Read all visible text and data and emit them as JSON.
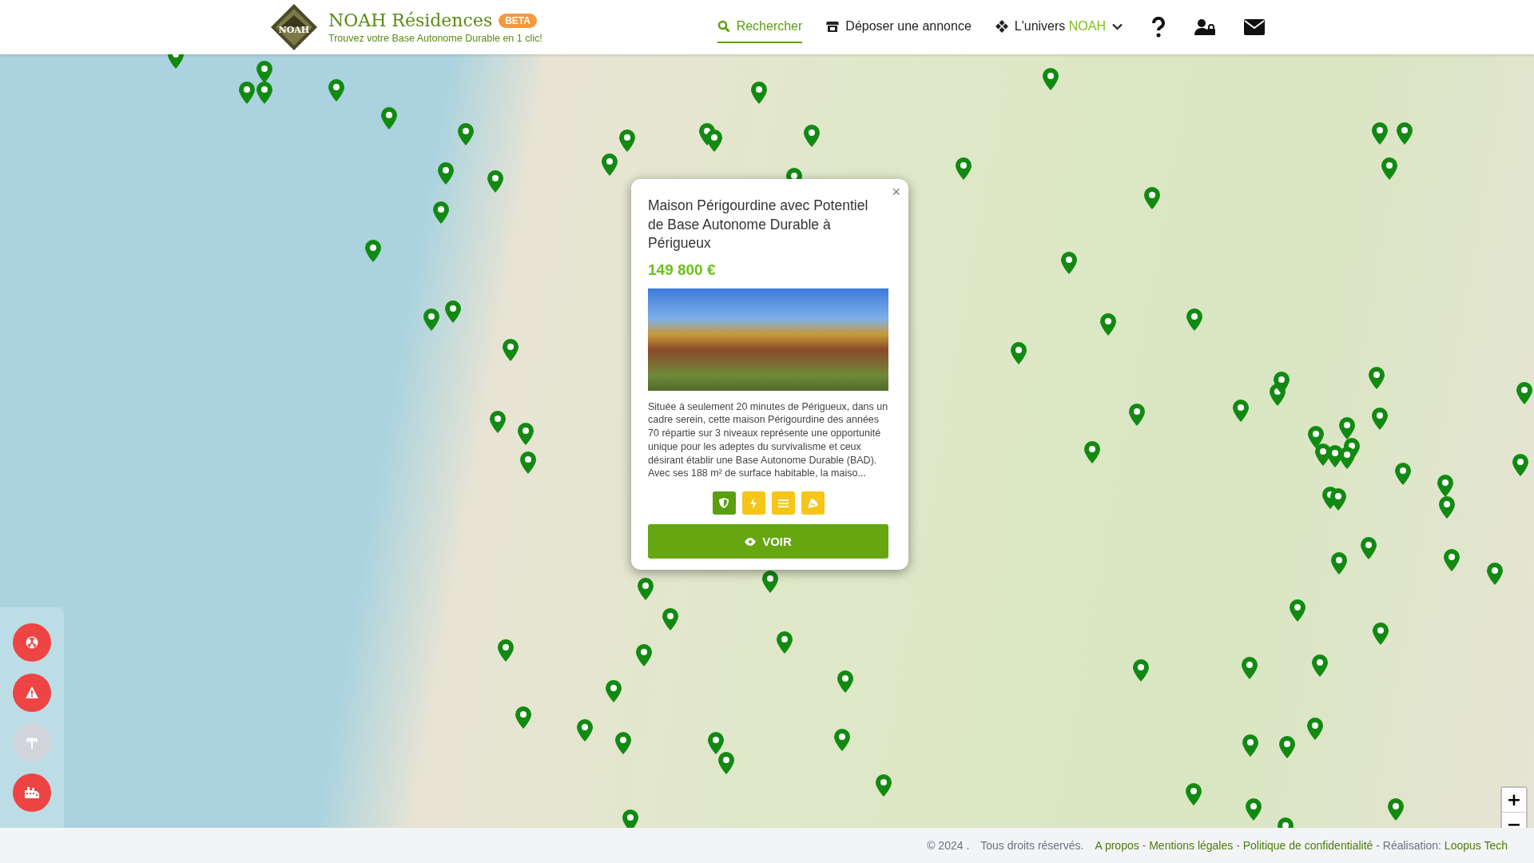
{
  "header": {
    "logo_text": "NOAH",
    "brand": "NOAH Résidences",
    "badge": "BETA",
    "tagline": "Trouvez votre Base Autonome Durable en 1 clic!",
    "nav": [
      {
        "kind": "search",
        "label": "Rechercher",
        "selected": true
      },
      {
        "kind": "post",
        "label": "Déposer une annonce",
        "selected": false
      },
      {
        "kind": "universe",
        "label": "L'univers ",
        "accent": "NOAH",
        "selected": false
      }
    ],
    "icon_buttons": [
      {
        "kind": "help"
      },
      {
        "kind": "account"
      },
      {
        "kind": "mail"
      }
    ]
  },
  "layer_buttons": [
    {
      "kind": "radiation",
      "active": true
    },
    {
      "kind": "warning",
      "active": true
    },
    {
      "kind": "antenna",
      "active": false
    },
    {
      "kind": "factory",
      "active": true
    }
  ],
  "zoom_controls": [
    "+",
    "−"
  ],
  "popup": {
    "close": "×",
    "title": "Maison Périgourdine avec Potentiel de Base Autonome Durable à Périgueux",
    "price": "149 800 €",
    "description": "Située à seulement 20 minutes de Périgueux, dans un cadre serein, cette maison Périgourdine des années 70 répartie sur 3 niveaux représente une opportunité unique pour les adeptes du survivalisme et ceux désirant établir une Base Autonome Durable (BAD). Avec ses 188 m² de surface habitable, la maiso...",
    "features": [
      {
        "kind": "shield",
        "color": "#5a9e12"
      },
      {
        "kind": "bolt",
        "color": "#f5c518"
      },
      {
        "kind": "water",
        "color": "#f5c518"
      },
      {
        "kind": "food",
        "color": "#f5c518"
      }
    ],
    "button": "VOIR"
  },
  "footer": {
    "copyright": "© 2024 .",
    "rights": "Tous droits réservés.",
    "links": [
      {
        "kind": "link",
        "text": "A propos"
      },
      {
        "kind": "sep",
        "text": " - "
      },
      {
        "kind": "link",
        "text": "Mentions légales"
      },
      {
        "kind": "sep",
        "text": " - "
      },
      {
        "kind": "link",
        "text": "Politique de confidentialité"
      },
      {
        "kind": "sep",
        "text": " - Réalisation: "
      },
      {
        "kind": "link",
        "text": "Loopus Tech"
      }
    ]
  }
}
